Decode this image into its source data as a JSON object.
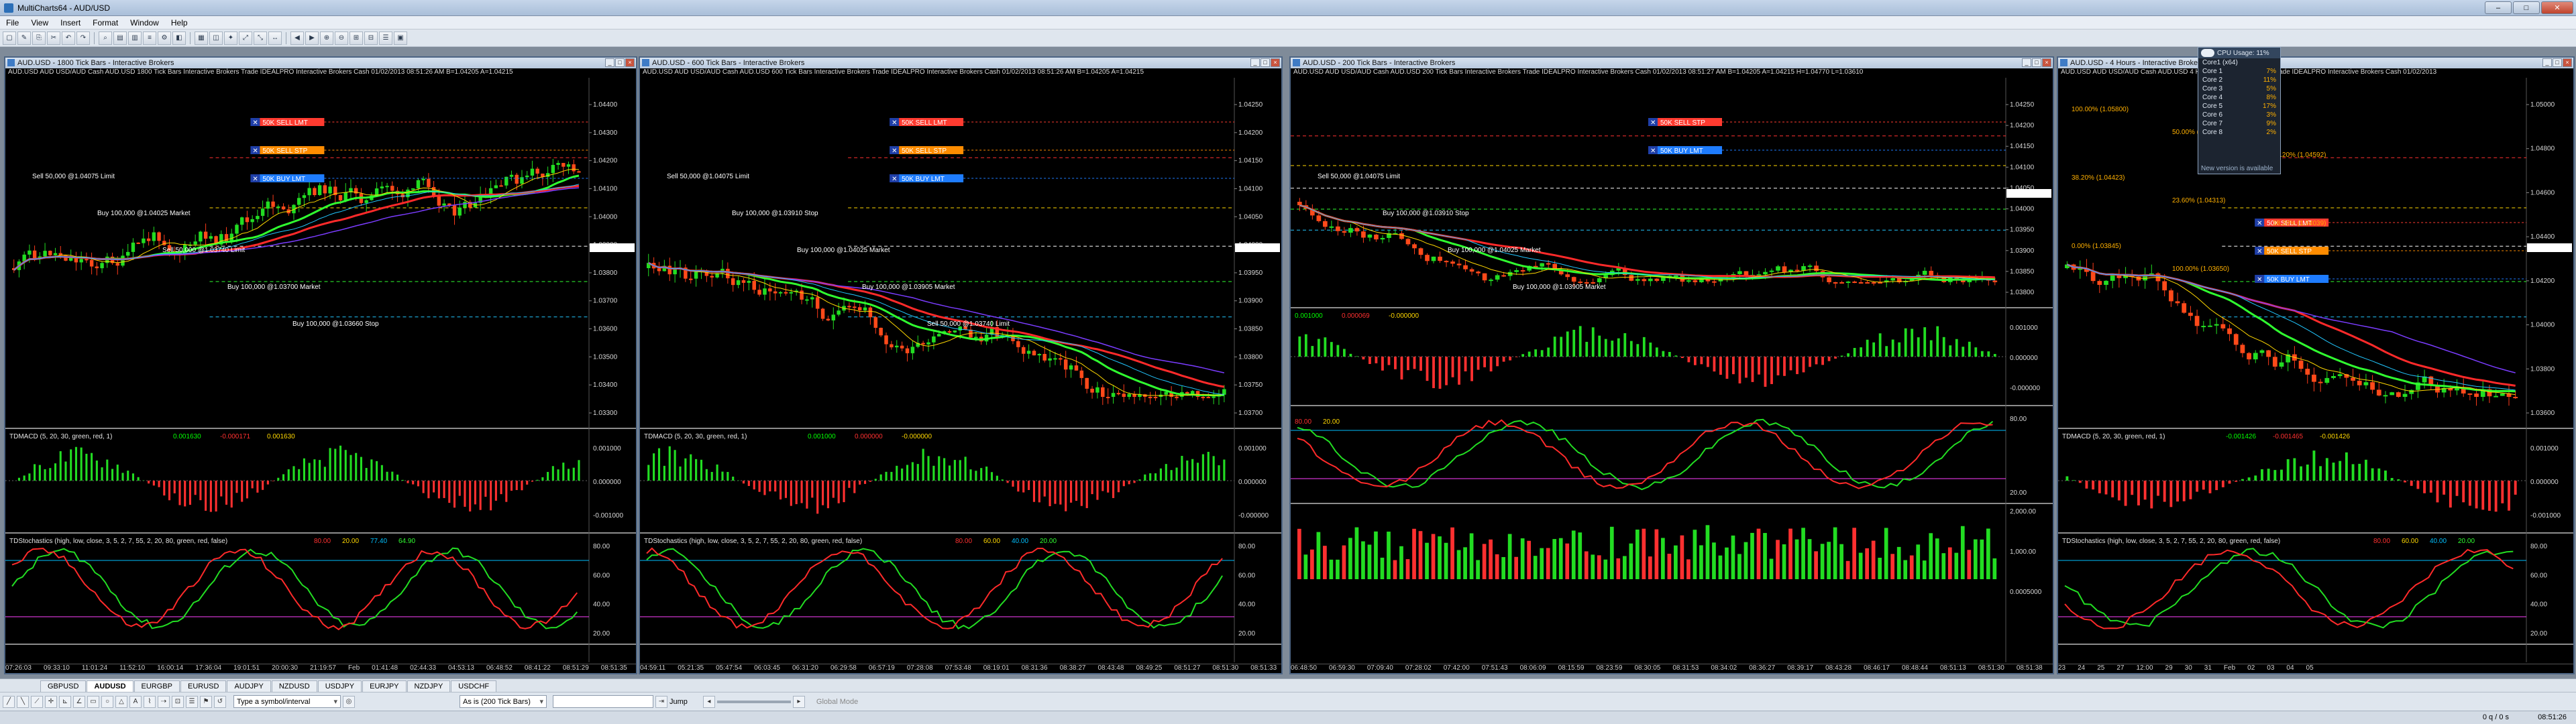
{
  "app": {
    "title": "MultiCharts64 - AUD/USD"
  },
  "window_buttons": [
    "–",
    "□",
    "✕"
  ],
  "menu": [
    "File",
    "View",
    "Insert",
    "Format",
    "Window",
    "Help"
  ],
  "cpu_widget": {
    "title": "CPU Usage: 11%",
    "sub": "Core1 (x64)",
    "rows": [
      {
        "k": "Core 1",
        "v": "7%"
      },
      {
        "k": "Core 2",
        "v": "11%"
      },
      {
        "k": "Core 3",
        "v": "5%"
      },
      {
        "k": "Core 4",
        "v": "8%"
      },
      {
        "k": "Core 5",
        "v": "17%"
      },
      {
        "k": "Core 6",
        "v": "3%"
      },
      {
        "k": "Core 7",
        "v": "9%"
      },
      {
        "k": "Core 8",
        "v": "2%"
      }
    ],
    "footer": "New version is available"
  },
  "charts": [
    {
      "title": "AUD.USD - 1800 Tick Bars - Interactive Brokers",
      "header": "AUD.USD  AUD USD/AUD Cash AUD.USD  1800 Tick Bars  Interactive Brokers        Trade  IDEALPRO  Interactive Brokers  Cash  01/02/2013  08:51:26 AM  B=1.04205  A=1.04215",
      "price_ticks": [
        "1.04400",
        "1.04300",
        "1.04200",
        "1.04100",
        "1.04000",
        "1.03900",
        "1.03800",
        "1.03700",
        "1.03600",
        "1.03500",
        "1.03400",
        "1.03300"
      ],
      "tags": [
        {
          "label": "50K  SELL LMT",
          "color": "#ff3b30"
        },
        {
          "label": "50K  SELL STP",
          "color": "#ff8c00"
        },
        {
          "label": "50K  BUY LMT",
          "color": "#1e7cff"
        }
      ],
      "annotations": [
        "Sell 50,000 @1.04075 Limit",
        "Buy 100,000 @1.04025 Market",
        "Sell 50,000 @1.03740 Limit",
        "Buy 100,000 @1.03700 Market",
        "Buy 100,000 @1.03660 Stop"
      ],
      "macd_label": "TDMACD (5, 20, 30, green, red, 1)",
      "macd_values": [
        "0.001630",
        "-0.000171",
        "0.001630"
      ],
      "macd_ticks": [
        "0.001000",
        "0.000000",
        "-0.001000"
      ],
      "stoch_label": "TDStochastics (high, low, close, 3, 5, 2, 7, 55, 2, 20, 80, green, red, false)",
      "stoch_values": [
        "80.00",
        "20.00",
        "77.40",
        "64.90"
      ],
      "stoch_ticks": [
        "80.00",
        "60.00",
        "40.00",
        "20.00"
      ],
      "times": [
        "07:26:03",
        "09:33:10",
        "11:01:24",
        "11:52:10",
        "16:00:14",
        "17:36:04",
        "19:01:51",
        "20:00:30",
        "21:19:57",
        "Feb",
        "01:41:48",
        "02:44:33",
        "04:53:13",
        "06:48:52",
        "08:41:22",
        "08:51:29",
        "08:51:35"
      ]
    },
    {
      "title": "AUD.USD - 600 Tick Bars - Interactive Brokers",
      "header": "AUD.USD  AUD USD/AUD Cash AUD.USD  600 Tick Bars  Interactive Brokers        Trade  IDEALPRO  Interactive Brokers  Cash  01/02/2013  08:51:26 AM  B=1.04205  A=1.04215",
      "price_ticks": [
        "1.04250",
        "1.04200",
        "1.04150",
        "1.04100",
        "1.04050",
        "1.04000",
        "1.03950",
        "1.03900",
        "1.03850",
        "1.03800",
        "1.03750",
        "1.03700"
      ],
      "tags": [
        {
          "label": "50K  SELL LMT",
          "color": "#ff3b30"
        },
        {
          "label": "50K  SELL STP",
          "color": "#ff8c00"
        },
        {
          "label": "50K  BUY LMT",
          "color": "#1e7cff"
        }
      ],
      "annotations": [
        "Sell 50,000 @1.04075 Limit",
        "Buy 100,000 @1.03910 Stop",
        "Buy 100,000 @1.04025 Market",
        "Buy 100,000 @1.03905 Market",
        "Sell 50,000 @1.03740 Limit"
      ],
      "macd_label": "TDMACD (5, 20, 30, green, red, 1)",
      "macd_values": [
        "0.001000",
        "0.000000",
        "-0.000000"
      ],
      "macd_ticks": [
        "0.001000",
        "0.000000",
        "-0.000000"
      ],
      "stoch_label": "TDStochastics (high, low, close, 3, 5, 2, 7, 55, 2, 20, 80, green, red, false)",
      "stoch_values": [
        "80.00",
        "60.00",
        "40.00",
        "20.00"
      ],
      "stoch_ticks": [
        "80.00",
        "60.00",
        "40.00",
        "20.00"
      ],
      "times": [
        "04:59:11",
        "05:21:35",
        "05:47:54",
        "06:03:45",
        "06:31:20",
        "06:29:58",
        "06:57:19",
        "07:28:08",
        "07:53:48",
        "08:19:01",
        "08:31:36",
        "08:38:27",
        "08:43:48",
        "08:49:25",
        "08:51:27",
        "08:51:30",
        "08:51:33"
      ]
    },
    {
      "title": "AUD.USD - 200 Tick Bars - Interactive Brokers",
      "header": "AUD.USD  AUD USD/AUD Cash AUD.USD  200 Tick Bars  Interactive Brokers        Trade  IDEALPRO  Interactive Brokers  Cash  01/02/2013  08:51:27 AM  B=1.04205  A=1.04215  H=1.04770  L=1.03610",
      "price_ticks": [
        "1.04250",
        "1.04200",
        "1.04150",
        "1.04100",
        "1.04050",
        "1.04000",
        "1.03950",
        "1.03900",
        "1.03850",
        "1.03800"
      ],
      "tags": [
        {
          "label": "50K  SELL STP",
          "color": "#ff3b30"
        },
        {
          "label": "50K  BUY LMT",
          "color": "#1e7cff"
        }
      ],
      "annotations": [
        "Sell 50,000 @1.04075 Limit",
        "Buy 100,000 @1.03910 Stop",
        "Buy 100,000 @1.04025 Market",
        "Buy 100,000 @1.03905 Market"
      ],
      "macd_label": "",
      "macd_values": [
        "0.001000",
        "0.000069",
        "-0.000000"
      ],
      "macd_ticks": [
        "0.001000",
        "0.000000",
        "-0.000000"
      ],
      "stoch_label": "",
      "stoch_values": [
        "80.00",
        "20.00"
      ],
      "stoch_ticks": [
        "80.00",
        "20.00"
      ],
      "volume_ticks": [
        "2,000.00",
        "1,000.00",
        "0.0005000"
      ],
      "times": [
        "06:48:50",
        "06:59:30",
        "07:09:40",
        "07:28:02",
        "07:42:00",
        "07:51:43",
        "08:06:09",
        "08:15:59",
        "08:23:59",
        "08:30:05",
        "08:31:53",
        "08:34:02",
        "08:36:27",
        "08:39:17",
        "08:43:28",
        "08:46:17",
        "08:48:44",
        "08:51:13",
        "08:51:30",
        "08:51:38"
      ]
    },
    {
      "title": "AUD.USD - 4 Hours - Interactive Brokers",
      "header": "AUD.USD  AUD USD/AUD Cash AUD.USD  4 Hours  Interactive Brokers        Trade  IDEALPRO  Interactive Brokers  Cash  01/02/2013",
      "price_ticks": [
        "1.05000",
        "1.04800",
        "1.04600",
        "1.04400",
        "1.04200",
        "1.04000",
        "1.03800",
        "1.03600"
      ],
      "tags": [
        {
          "label": "50K  SELL LMT",
          "color": "#ff3b30"
        },
        {
          "label": "50K  SELL STP",
          "color": "#ff8c00"
        },
        {
          "label": "50K  BUY LMT",
          "color": "#1e7cff"
        }
      ],
      "annotations": [
        "100.00% (1.05800)",
        "50.00% (1.04706)",
        "38.20% (1.04592)",
        "38.20% (1.04423)",
        "23.60% (1.04313)",
        "38.20% (1.04039)",
        "0.00% (1.03845)",
        "100.00% (1.03650)"
      ],
      "macd_label": "TDMACD (5, 20, 30, green, red, 1)",
      "macd_values": [
        "-0.001426",
        "-0.001465",
        "-0.001426"
      ],
      "macd_ticks": [
        "0.001000",
        "0.000000",
        "-0.001000"
      ],
      "stoch_label": "TDStochastics (high, low, close, 3, 5, 2, 7, 55, 2, 20, 80, green, red, false)",
      "stoch_values": [
        "80.00",
        "60.00",
        "40.00",
        "20.00"
      ],
      "stoch_ticks": [
        "80.00",
        "60.00",
        "40.00",
        "20.00"
      ],
      "times": [
        "23",
        "24",
        "25",
        "27",
        "12:00",
        "29",
        "30",
        "31",
        "Feb",
        "02",
        "03",
        "04",
        "05"
      ]
    }
  ],
  "symbol_tabs": [
    "GBPUSD",
    "AUDUSD",
    "EURGBP",
    "EURUSD",
    "AUDJPY",
    "NZDUSD",
    "USDJPY",
    "EURJPY",
    "NZDJPY",
    "USDCHF"
  ],
  "active_tab": "AUDUSD",
  "drawbar": {
    "symbol_placeholder": "Type a symbol/interval",
    "interval_combo": "As is (200 Tick Bars)",
    "jump_label": "Jump",
    "global_mode": "Global Mode"
  },
  "status": {
    "right": "0 q / 0 s",
    "time": "08:51:26"
  }
}
